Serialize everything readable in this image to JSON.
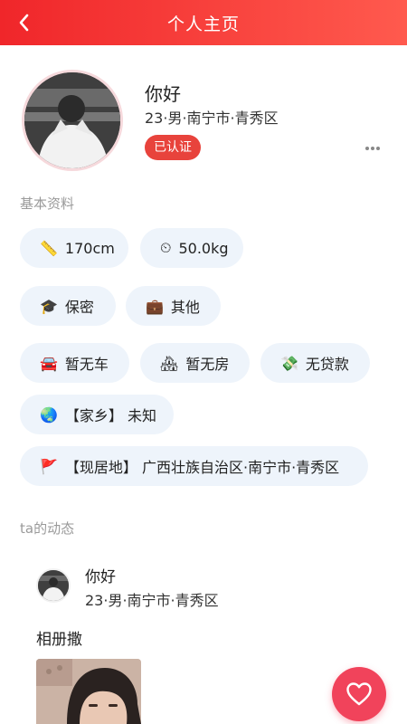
{
  "header": {
    "title": "个人主页",
    "back_icon": "chevron-left-icon"
  },
  "profile": {
    "name": "你好",
    "meta": "23·男·南宁市·青秀区",
    "badge": "已认证",
    "more_icon": "ellipsis-icon"
  },
  "basic_info": {
    "title": "基本资料",
    "chips": [
      {
        "icon": "📏",
        "icon_name": "ruler-icon",
        "label": "170cm"
      },
      {
        "icon": "⏲",
        "icon_name": "scale-icon",
        "label": "50.0kg"
      },
      {
        "icon": "🎓",
        "icon_name": "graduation-cap-icon",
        "label": "保密"
      },
      {
        "icon": "💼",
        "icon_name": "briefcase-icon",
        "label": "其他"
      },
      {
        "icon": "🚘",
        "icon_name": "car-icon",
        "label": "暂无车"
      },
      {
        "icon": "🏘",
        "icon_name": "house-icon",
        "label": "暂无房"
      },
      {
        "icon": "💸",
        "icon_name": "money-icon",
        "label": "无贷款"
      },
      {
        "icon": "🌏",
        "icon_name": "globe-icon",
        "label": "【家乡】 未知"
      },
      {
        "icon": "🚩",
        "icon_name": "flag-icon",
        "label": "【现居地】 广西壮族自治区·南宁市·青秀区"
      }
    ]
  },
  "moments": {
    "title": "ta的动态",
    "post": {
      "name": "你好",
      "meta": "23·男·南宁市·青秀区",
      "text": "相册撒"
    }
  },
  "fab": {
    "icon": "heart-icon"
  },
  "colors": {
    "brand_red": "#f0262a",
    "badge_red": "#e8433c",
    "fab_pink": "#f1435b",
    "chip_bg": "#eef4fb"
  }
}
